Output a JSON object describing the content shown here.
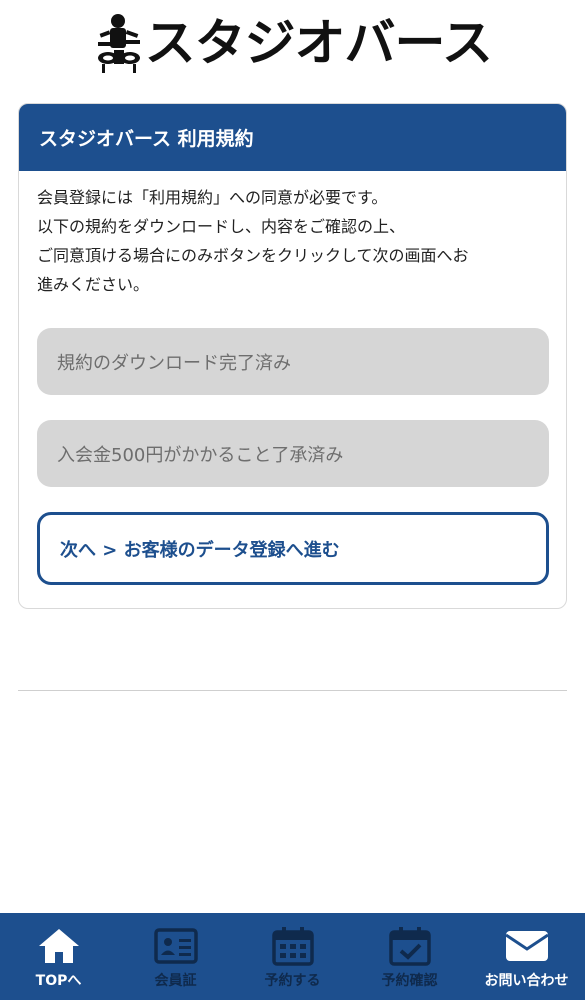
{
  "header": {
    "logo_text": "スタジオバース"
  },
  "terms_card": {
    "title": "スタジオバース 利用規約",
    "intro_lines": [
      "会員登録には「利用規約」への同意が必要です。",
      "以下の規約をダウンロードし、内容をご確認の上、",
      "ご同意頂ける場合にのみボタンをクリックして次の画面へお",
      "進みください。"
    ],
    "download_button_label": "規約のダウンロード完了済み",
    "admission_fee_button_label": "入会金500円がかかること了承済み",
    "next_button_label": "次へ > お客様のデータ登録へ進む"
  },
  "tabbar": {
    "items": [
      {
        "label": "TOPへ",
        "icon": "home-icon",
        "state": "active"
      },
      {
        "label": "会員証",
        "icon": "id-card-icon",
        "state": "inactive"
      },
      {
        "label": "予約する",
        "icon": "calendar-icon",
        "state": "inactive"
      },
      {
        "label": "予約確認",
        "icon": "calendar-check-icon",
        "state": "inactive"
      },
      {
        "label": "お問い合わせ",
        "icon": "mail-icon",
        "state": "active"
      }
    ]
  },
  "colors": {
    "brand_blue": "#1d4f8e",
    "disabled_button": "#d6d6d6",
    "inactive_tab": "#0f2a4d"
  }
}
